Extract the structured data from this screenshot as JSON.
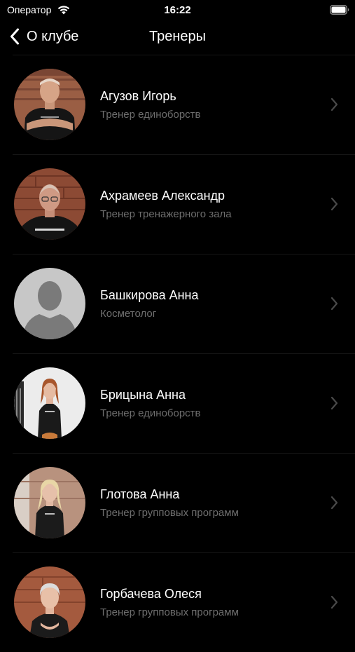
{
  "status_bar": {
    "carrier": "Оператор",
    "time": "16:22"
  },
  "nav": {
    "back_label": "О клубе",
    "title": "Тренеры"
  },
  "trainers": [
    {
      "name": "Агузов Игорь",
      "role": "Тренер единоборств",
      "avatar": "photo-man-black-shirt"
    },
    {
      "name": "Ахрамеев Александр",
      "role": "Тренер тренажерного зала",
      "avatar": "photo-man-glasses"
    },
    {
      "name": "Башкирова Анна",
      "role": "Косметолог",
      "avatar": "placeholder-silhouette"
    },
    {
      "name": "Брицына Анна",
      "role": "Тренер единоборств",
      "avatar": "photo-woman-white-background"
    },
    {
      "name": "Глотова Анна",
      "role": "Тренер групповых программ",
      "avatar": "photo-woman-blonde"
    },
    {
      "name": "Горбачева Олеся",
      "role": "Тренер групповых программ",
      "avatar": "photo-woman-short-hair"
    }
  ]
}
